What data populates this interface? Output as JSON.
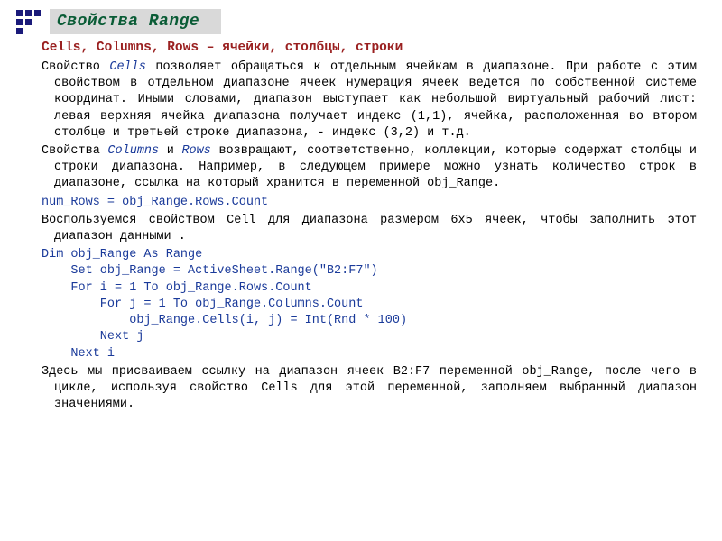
{
  "title": "Свойства Range",
  "section_head": "Cells, Columns, Rows – ячейки, столбцы, строки",
  "p1_a": "Свойство ",
  "p1_kw1": "Cells",
  "p1_b": " позволяет обращаться к отдельным ячейкам в диапазоне. При работе с этим свойством в отдельном диапазоне ячеек нумерация ячеек ведется по собственной системе координат. Иными словами, диапазон выступает как небольшой виртуальный рабочий лист: левая верхняя ячейка диапазона получает индекс (1,1), ячейка, расположенная во втором столбце и третьей строке диапазона, - индекс (3,2) и т.д.",
  "p2_a": "Свойства ",
  "p2_kw1": "Columns",
  "p2_b": " и ",
  "p2_kw2": "Rows",
  "p2_c": " возвращают, соответственно, коллекции, которые содержат столбцы и строки диапазона. Например, в следующем примере можно узнать количество строк в диапазоне, ссылка на который хранится в переменной obj_Range.",
  "code1": "num_Rows = obj_Range.Rows.Count",
  "desc1": " Воспользуемся свойством Cell для диапазона размером 6х5 ячеек, чтобы заполнить этот диапазон данными .",
  "code2": "Dim obj_Range As Range\n    Set obj_Range = ActiveSheet.Range(\"B2:F7\")\n    For i = 1 To obj_Range.Rows.Count\n        For j = 1 To obj_Range.Columns.Count\n            obj_Range.Cells(i, j) = Int(Rnd * 100)\n        Next j\n    Next i",
  "p3": "Здесь мы присваиваем ссылку на диапазон ячеек B2:F7 переменной obj_Range, после чего в цикле, используя свойство Cells для этой переменной, заполняем выбранный диапазон значениями.",
  "chart_data": {
    "type": "table",
    "note": "No chart present; document slide with code sample"
  }
}
